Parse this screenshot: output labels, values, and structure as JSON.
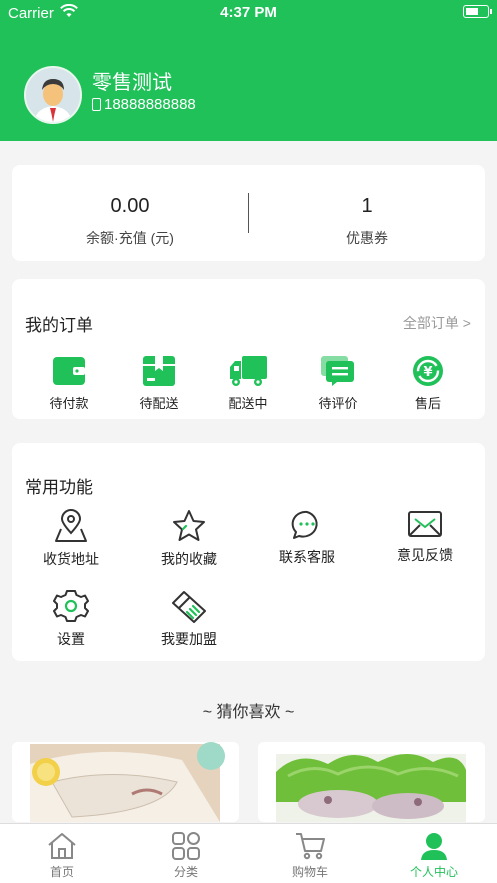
{
  "status_bar": {
    "carrier": "Carrier",
    "time": "4:37 PM"
  },
  "profile": {
    "name": "零售测试",
    "phone": "18888888888"
  },
  "balance": {
    "amount": "0.00",
    "amount_label": "余额·充值 (元)",
    "coupons": "1",
    "coupons_label": "优惠券"
  },
  "orders": {
    "title": "我的订单",
    "all_link": "全部订单 >",
    "items": [
      {
        "label": "待付款",
        "icon": "wallet-icon"
      },
      {
        "label": "待配送",
        "icon": "package-icon"
      },
      {
        "label": "配送中",
        "icon": "truck-icon"
      },
      {
        "label": "待评价",
        "icon": "comment-icon"
      },
      {
        "label": "售后",
        "icon": "yuan-refresh-icon"
      }
    ]
  },
  "functions": {
    "title": "常用功能",
    "items": [
      {
        "label": "收货地址",
        "icon": "location-icon"
      },
      {
        "label": "我的收藏",
        "icon": "star-icon"
      },
      {
        "label": "联系客服",
        "icon": "chat-icon"
      },
      {
        "label": "意见反馈",
        "icon": "mail-icon"
      },
      {
        "label": "设置",
        "icon": "gear-icon"
      },
      {
        "label": "我要加盟",
        "icon": "handshake-icon"
      }
    ]
  },
  "recommend": {
    "title": "~ 猜你喜欢 ~"
  },
  "tabbar": {
    "items": [
      {
        "label": "首页",
        "icon": "home-icon"
      },
      {
        "label": "分类",
        "icon": "grid-icon"
      },
      {
        "label": "购物车",
        "icon": "cart-icon"
      },
      {
        "label": "个人中心",
        "icon": "person-icon"
      }
    ],
    "active_index": 3
  },
  "colors": {
    "brand": "#21c15a",
    "background": "#f4f4f4"
  }
}
